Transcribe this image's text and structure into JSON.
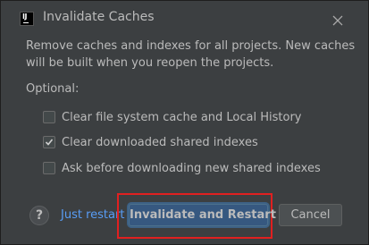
{
  "dialog": {
    "title": "Invalidate Caches",
    "app_icon_text": "IJ",
    "description": "Remove caches and indexes for all projects. New caches will be built when you reopen the projects.",
    "optional_label": "Optional:",
    "options": [
      {
        "label": "Clear file system cache and Local History",
        "checked": false
      },
      {
        "label": "Clear downloaded shared indexes",
        "checked": true
      },
      {
        "label": "Ask before downloading new shared indexes",
        "checked": false
      }
    ],
    "help_label": "?",
    "just_restart_label": "Just restart",
    "primary_button_label": "Invalidate and Restart",
    "cancel_button_label": "Cancel"
  },
  "colors": {
    "background": "#3c3f41",
    "text": "#bbbbbb",
    "link": "#589df6",
    "primary_button": "#365880",
    "highlight_box": "#e02020"
  }
}
